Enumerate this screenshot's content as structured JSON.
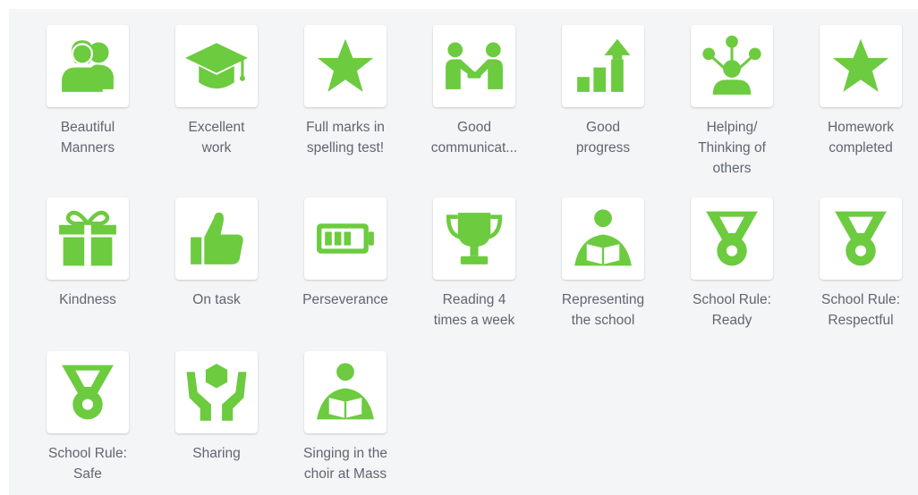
{
  "colors": {
    "icon_green": "#6ccb3f",
    "label_text": "#5f6670",
    "panel_bg": "#f4f5f7",
    "tile_bg": "#ffffff"
  },
  "skills": [
    {
      "label": "Beautiful\nManners",
      "icon": "people-icon"
    },
    {
      "label": "Excellent\nwork",
      "icon": "graduation-cap-icon"
    },
    {
      "label": "Full marks in\nspelling test!",
      "icon": "star-icon"
    },
    {
      "label": "Good\ncommunicat...",
      "icon": "handshake-icon"
    },
    {
      "label": "Good\nprogress",
      "icon": "growth-chart-icon"
    },
    {
      "label": "Helping/\nThinking of\nothers",
      "icon": "idea-network-icon"
    },
    {
      "label": "Homework\ncompleted",
      "icon": "star-icon"
    },
    {
      "label": "Kindness",
      "icon": "gift-icon"
    },
    {
      "label": "On task",
      "icon": "thumbs-up-icon"
    },
    {
      "label": "Perseverance",
      "icon": "battery-icon"
    },
    {
      "label": "Reading 4\ntimes a week",
      "icon": "trophy-icon"
    },
    {
      "label": "Representing\nthe school",
      "icon": "reader-icon"
    },
    {
      "label": "School Rule:\nReady",
      "icon": "medal-icon"
    },
    {
      "label": "School Rule:\nRespectful",
      "icon": "medal-icon"
    },
    {
      "label": "School Rule:\nSafe",
      "icon": "medal-icon"
    },
    {
      "label": "Sharing",
      "icon": "sharing-hands-icon"
    },
    {
      "label": "Singing in the\nchoir at Mass",
      "icon": "reader-icon"
    }
  ]
}
